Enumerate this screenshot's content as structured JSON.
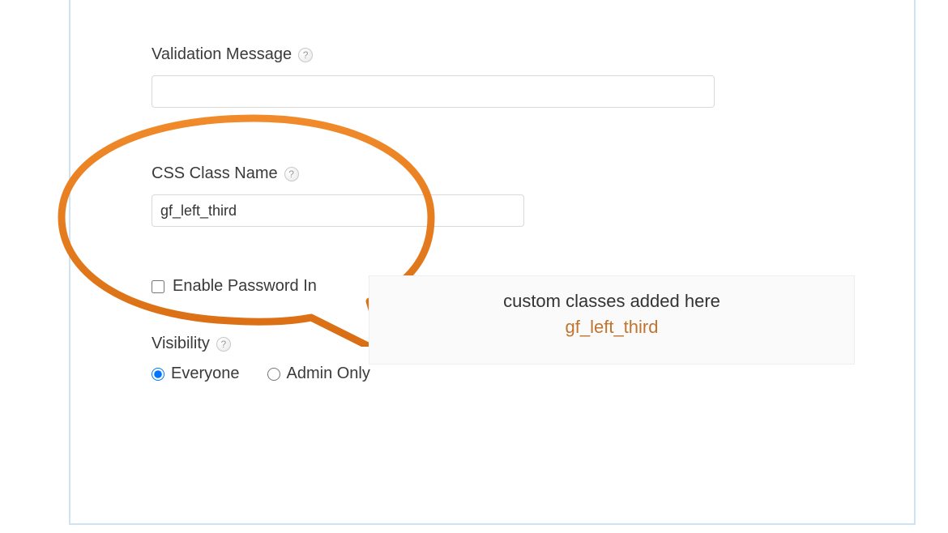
{
  "validation_message": {
    "label": "Validation Message",
    "value": ""
  },
  "css_class": {
    "label": "CSS Class Name",
    "value": "gf_left_third"
  },
  "enable_password": {
    "label": "Enable Password In",
    "checked": false
  },
  "visibility": {
    "label": "Visibility",
    "options": [
      {
        "label": "Everyone",
        "value": "everyone",
        "selected": true
      },
      {
        "label": "Admin Only",
        "value": "admin",
        "selected": false
      }
    ]
  },
  "annotation": {
    "line1": "custom classes added here",
    "line2": "gf_left_third"
  }
}
